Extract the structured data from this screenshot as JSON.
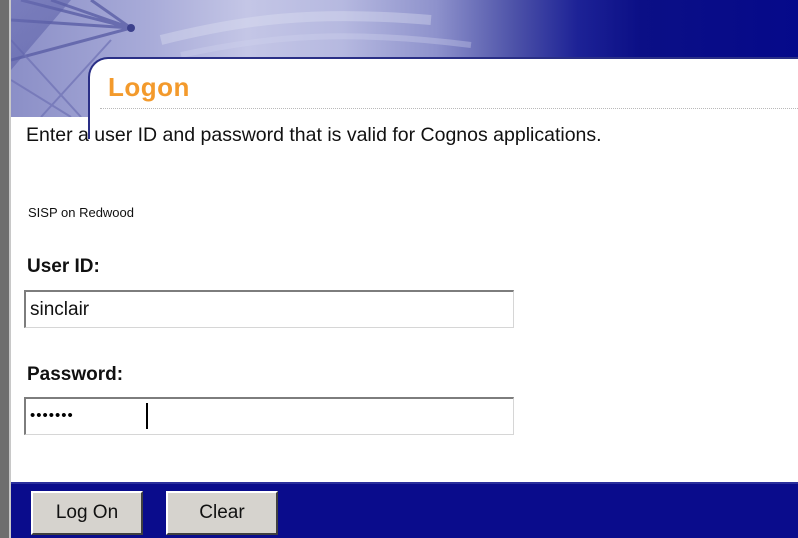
{
  "header": {
    "title": "Logon"
  },
  "form": {
    "instructions": "Enter a user ID and password that is valid for Cognos applications.",
    "namespace": "SISP on Redwood",
    "user_id_label": "User ID:",
    "user_id_value": "sinclair",
    "password_label": "Password:",
    "password_masked": "•••••••"
  },
  "buttons": {
    "logon_label": "Log On",
    "clear_label": "Clear"
  },
  "colors": {
    "title": "#f39a2c",
    "banner_dark": "#05098a",
    "button_bar": "#0a0c8c",
    "button_face": "#d6d3ce"
  }
}
